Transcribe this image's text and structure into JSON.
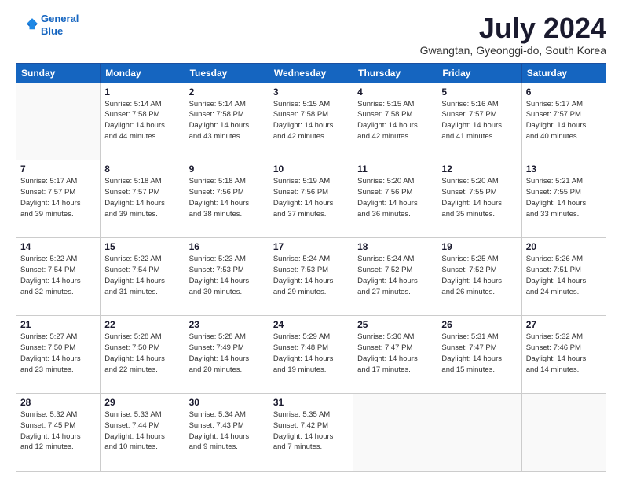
{
  "header": {
    "logo_line1": "General",
    "logo_line2": "Blue",
    "month_title": "July 2024",
    "subtitle": "Gwangtan, Gyeonggi-do, South Korea"
  },
  "weekdays": [
    "Sunday",
    "Monday",
    "Tuesday",
    "Wednesday",
    "Thursday",
    "Friday",
    "Saturday"
  ],
  "weeks": [
    [
      {
        "day": "",
        "empty": true
      },
      {
        "day": "1",
        "sunrise": "5:14 AM",
        "sunset": "7:58 PM",
        "daylight": "14 hours and 44 minutes."
      },
      {
        "day": "2",
        "sunrise": "5:14 AM",
        "sunset": "7:58 PM",
        "daylight": "14 hours and 43 minutes."
      },
      {
        "day": "3",
        "sunrise": "5:15 AM",
        "sunset": "7:58 PM",
        "daylight": "14 hours and 42 minutes."
      },
      {
        "day": "4",
        "sunrise": "5:15 AM",
        "sunset": "7:58 PM",
        "daylight": "14 hours and 42 minutes."
      },
      {
        "day": "5",
        "sunrise": "5:16 AM",
        "sunset": "7:57 PM",
        "daylight": "14 hours and 41 minutes."
      },
      {
        "day": "6",
        "sunrise": "5:17 AM",
        "sunset": "7:57 PM",
        "daylight": "14 hours and 40 minutes."
      }
    ],
    [
      {
        "day": "7",
        "sunrise": "5:17 AM",
        "sunset": "7:57 PM",
        "daylight": "14 hours and 39 minutes."
      },
      {
        "day": "8",
        "sunrise": "5:18 AM",
        "sunset": "7:57 PM",
        "daylight": "14 hours and 39 minutes."
      },
      {
        "day": "9",
        "sunrise": "5:18 AM",
        "sunset": "7:56 PM",
        "daylight": "14 hours and 38 minutes."
      },
      {
        "day": "10",
        "sunrise": "5:19 AM",
        "sunset": "7:56 PM",
        "daylight": "14 hours and 37 minutes."
      },
      {
        "day": "11",
        "sunrise": "5:20 AM",
        "sunset": "7:56 PM",
        "daylight": "14 hours and 36 minutes."
      },
      {
        "day": "12",
        "sunrise": "5:20 AM",
        "sunset": "7:55 PM",
        "daylight": "14 hours and 35 minutes."
      },
      {
        "day": "13",
        "sunrise": "5:21 AM",
        "sunset": "7:55 PM",
        "daylight": "14 hours and 33 minutes."
      }
    ],
    [
      {
        "day": "14",
        "sunrise": "5:22 AM",
        "sunset": "7:54 PM",
        "daylight": "14 hours and 32 minutes."
      },
      {
        "day": "15",
        "sunrise": "5:22 AM",
        "sunset": "7:54 PM",
        "daylight": "14 hours and 31 minutes."
      },
      {
        "day": "16",
        "sunrise": "5:23 AM",
        "sunset": "7:53 PM",
        "daylight": "14 hours and 30 minutes."
      },
      {
        "day": "17",
        "sunrise": "5:24 AM",
        "sunset": "7:53 PM",
        "daylight": "14 hours and 29 minutes."
      },
      {
        "day": "18",
        "sunrise": "5:24 AM",
        "sunset": "7:52 PM",
        "daylight": "14 hours and 27 minutes."
      },
      {
        "day": "19",
        "sunrise": "5:25 AM",
        "sunset": "7:52 PM",
        "daylight": "14 hours and 26 minutes."
      },
      {
        "day": "20",
        "sunrise": "5:26 AM",
        "sunset": "7:51 PM",
        "daylight": "14 hours and 24 minutes."
      }
    ],
    [
      {
        "day": "21",
        "sunrise": "5:27 AM",
        "sunset": "7:50 PM",
        "daylight": "14 hours and 23 minutes."
      },
      {
        "day": "22",
        "sunrise": "5:28 AM",
        "sunset": "7:50 PM",
        "daylight": "14 hours and 22 minutes."
      },
      {
        "day": "23",
        "sunrise": "5:28 AM",
        "sunset": "7:49 PM",
        "daylight": "14 hours and 20 minutes."
      },
      {
        "day": "24",
        "sunrise": "5:29 AM",
        "sunset": "7:48 PM",
        "daylight": "14 hours and 19 minutes."
      },
      {
        "day": "25",
        "sunrise": "5:30 AM",
        "sunset": "7:47 PM",
        "daylight": "14 hours and 17 minutes."
      },
      {
        "day": "26",
        "sunrise": "5:31 AM",
        "sunset": "7:47 PM",
        "daylight": "14 hours and 15 minutes."
      },
      {
        "day": "27",
        "sunrise": "5:32 AM",
        "sunset": "7:46 PM",
        "daylight": "14 hours and 14 minutes."
      }
    ],
    [
      {
        "day": "28",
        "sunrise": "5:32 AM",
        "sunset": "7:45 PM",
        "daylight": "14 hours and 12 minutes."
      },
      {
        "day": "29",
        "sunrise": "5:33 AM",
        "sunset": "7:44 PM",
        "daylight": "14 hours and 10 minutes."
      },
      {
        "day": "30",
        "sunrise": "5:34 AM",
        "sunset": "7:43 PM",
        "daylight": "14 hours and 9 minutes."
      },
      {
        "day": "31",
        "sunrise": "5:35 AM",
        "sunset": "7:42 PM",
        "daylight": "14 hours and 7 minutes."
      },
      {
        "day": "",
        "empty": true
      },
      {
        "day": "",
        "empty": true
      },
      {
        "day": "",
        "empty": true
      }
    ]
  ],
  "labels": {
    "sunrise": "Sunrise:",
    "sunset": "Sunset:",
    "daylight": "Daylight:"
  }
}
